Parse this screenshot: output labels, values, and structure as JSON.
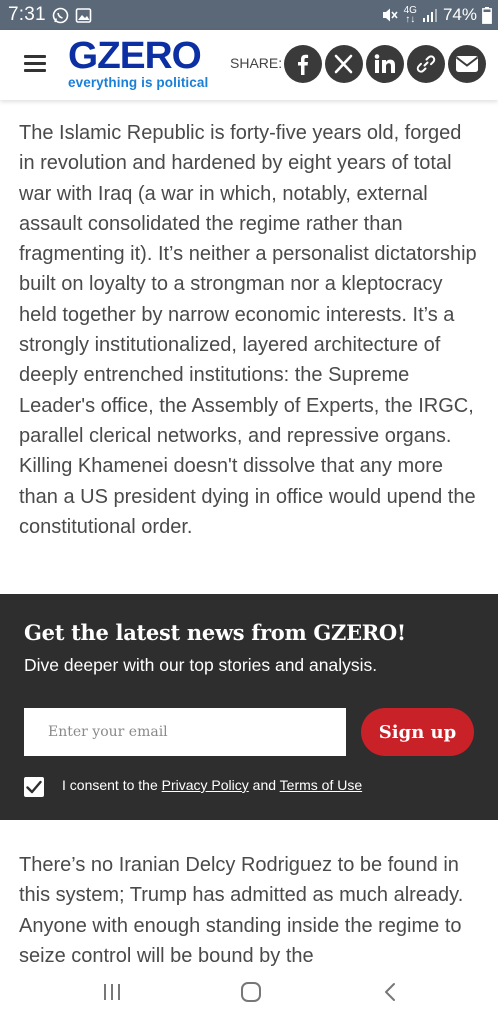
{
  "status_bar": {
    "time": "7:31",
    "battery": "74%",
    "network": "4G",
    "icons": [
      "whatsapp-icon",
      "gallery-icon",
      "mute-icon",
      "signal-icon",
      "battery-icon"
    ]
  },
  "header": {
    "logo_text": "GZERO",
    "tagline": "everything is political",
    "share_label": "SHARE:",
    "share_icons": [
      "facebook-icon",
      "x-icon",
      "linkedin-icon",
      "link-icon",
      "email-icon"
    ]
  },
  "article": {
    "paragraph_1": "The Islamic Republic is forty-five years old, forged in revolution and hardened by eight years of total war with Iraq (a war in which, notably, external assault consolidated the regime rather than fragmenting it). It’s neither a personalist dictatorship built on loyalty to a strongman nor a kleptocracy held together by narrow economic interests. It’s a strongly institutionalized, layered architecture of deeply entrenched institutions: the Supreme Leader's office, the Assembly of Experts, the IRGC, parallel clerical networks, and repressive organs. Killing Khamenei doesn't dissolve that any more than a US president dying in office would upend the constitutional order.",
    "paragraph_2": "There’s no Iranian Delcy Rodriguez to be found in this system; Trump has admitted as much already. Anyone with enough standing inside the regime to seize control will be bound by the"
  },
  "newsletter": {
    "title": "Get the latest news from GZERO!",
    "subtitle": "Dive deeper with our top stories and analysis.",
    "email_placeholder": "Enter your email",
    "signup_label": "Sign up",
    "consent_prefix": "I consent to the ",
    "privacy_link": "Privacy Policy",
    "consent_and": " and ",
    "terms_link": "Terms of Use",
    "consent_checked": true
  },
  "nav_bar": {
    "icons": [
      "recent-apps-icon",
      "home-icon",
      "back-icon"
    ]
  },
  "colors": {
    "status_bar": "#5b6878",
    "logo_blue": "#0c2fa3",
    "tagline_blue": "#1b7fd8",
    "newsletter_bg": "#2e2e2e",
    "signup_red": "#c92128",
    "share_icon_bg": "#3a3a3a"
  }
}
